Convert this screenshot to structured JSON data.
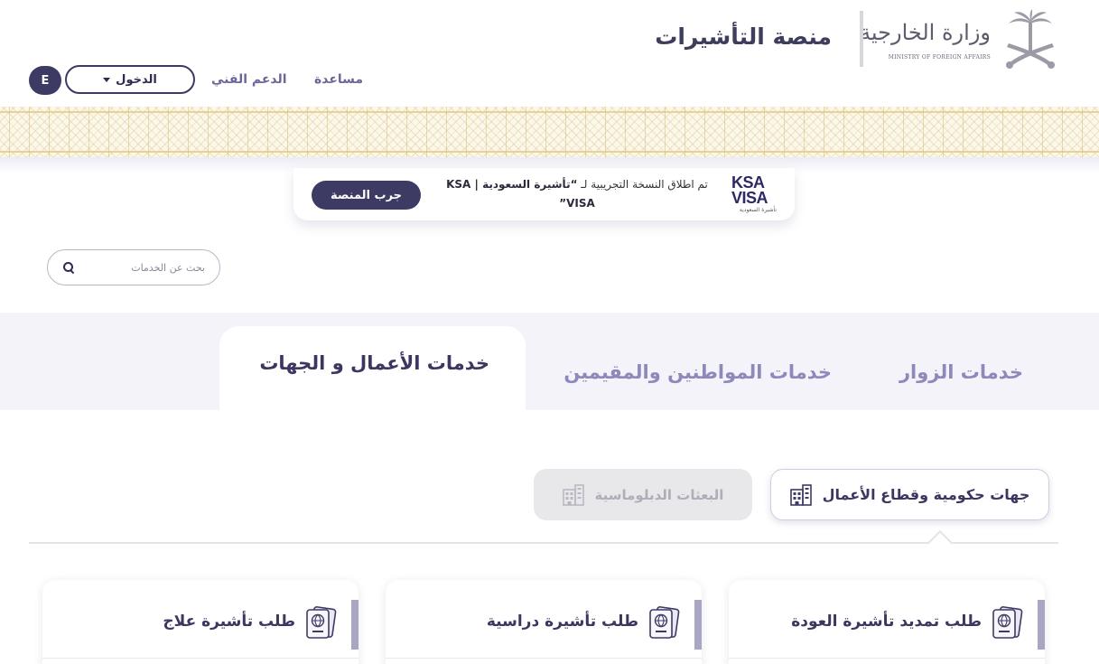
{
  "header": {
    "logo": {
      "name_ar": "وزارة الخارجية",
      "name_en": "MINISTRY OF FOREIGN AFFAIRS"
    },
    "site_title": "منصة التأشيرات",
    "nav": {
      "help": "مساعدة",
      "support": "الدعم الفني",
      "login": "الدخول",
      "language": "E"
    }
  },
  "announcement": {
    "logo_line1": "KSA",
    "logo_line2": "VISA",
    "logo_sub": "تأشيرة السعودية",
    "text_prefix": "تم اطلاق النسخة التجريبية لـ ",
    "text_highlight": "“تأشيرة السعودية | KSA VISA”",
    "button": "جرب المنصة"
  },
  "search": {
    "placeholder": "بحث عن الخدمات"
  },
  "tabs": {
    "visitors": "خدمات الزوار",
    "citizens": "خدمات المواطنين والمقيمين",
    "business": "خدمات الأعمال و الجهات",
    "active": "business"
  },
  "subtabs": {
    "government": "جهات حكومية وقطاع الأعمال",
    "diplomatic": "البعثات الدبلوماسية",
    "active": "government"
  },
  "cards": [
    {
      "title": "طلب تمديد تأشيرة العودة",
      "icon": "passport-icon"
    },
    {
      "title": "طلب تأشيرة دراسية",
      "icon": "passport-icon"
    },
    {
      "title": "طلب تأشيرة علاج",
      "icon": "passport-icon"
    }
  ],
  "colors": {
    "primary": "#3d3a64",
    "tab_inactive": "#8d89ba",
    "pattern_gold": "#e6d39a",
    "band_bg": "#f4f3fa"
  }
}
